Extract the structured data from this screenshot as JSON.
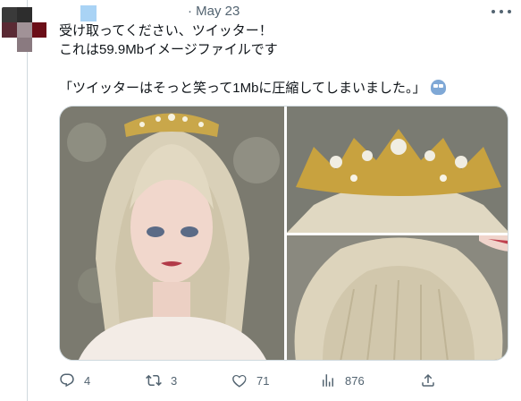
{
  "header": {
    "date_meta": "· May 23"
  },
  "tweet": {
    "lines": [
      "受け取ってください、ツイッター！",
      "これは59.9Mbイメージファイルです",
      "「ツイッターはそっと笑って1Mbに圧縮してしまいました。」"
    ]
  },
  "icons": {
    "more": "more-icon",
    "emoji": "robot-face-icon",
    "reply": "reply-icon",
    "retweet": "retweet-icon",
    "like": "heart-icon",
    "views": "views-icon",
    "share": "share-icon"
  },
  "actions": {
    "replies": "4",
    "retweets": "3",
    "likes": "71",
    "views": "876"
  },
  "colors": {
    "text": "#0f1419",
    "secondary": "#536471",
    "border": "#cfd9de"
  }
}
